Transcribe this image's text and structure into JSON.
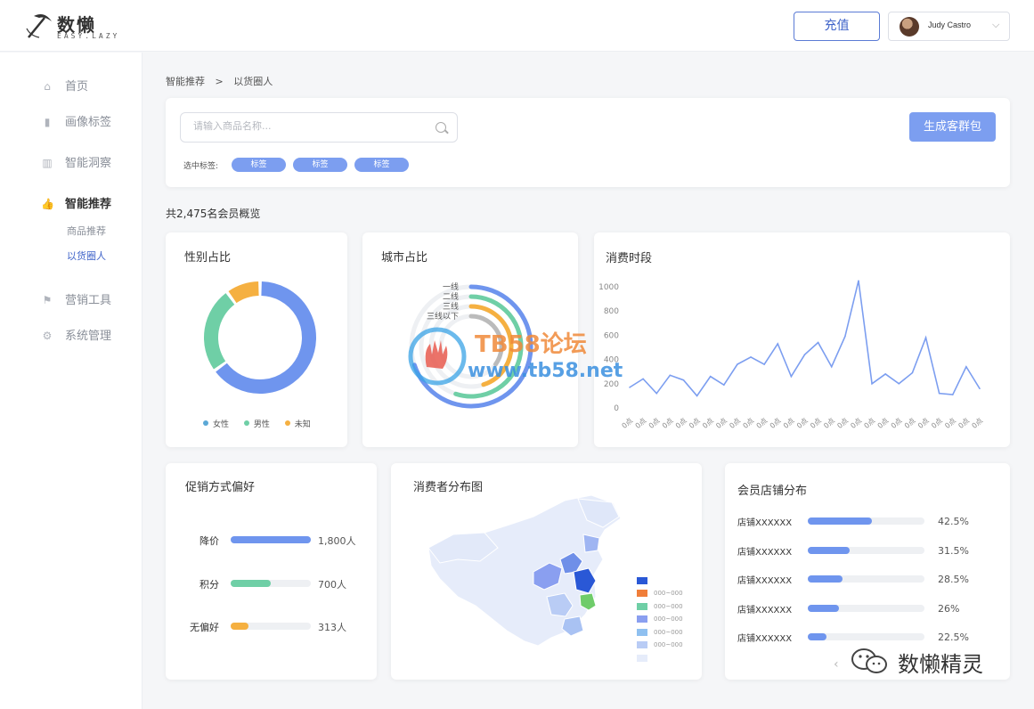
{
  "header": {
    "logo_title": "数懒",
    "logo_subtitle": "EASY.LAZY",
    "recharge_label": "充值",
    "user_name": "Judy Castro"
  },
  "sidebar": {
    "items": [
      {
        "label": "首页",
        "icon": "home-icon"
      },
      {
        "label": "画像标签",
        "icon": "bookmark-icon"
      },
      {
        "label": "智能洞察",
        "icon": "bar-chart-icon"
      },
      {
        "label": "智能推荐",
        "icon": "thumbs-up-icon"
      },
      {
        "label": "营销工具",
        "icon": "flag-icon"
      },
      {
        "label": "系统管理",
        "icon": "gear-icon"
      }
    ],
    "sub_items": [
      {
        "label": "商品推荐"
      },
      {
        "label": "以货圈人"
      }
    ],
    "active_item": "智能推荐",
    "active_sub_item": "以货圈人"
  },
  "breadcrumb": {
    "parent": "智能推荐",
    "separator": ">",
    "current": "以货圈人"
  },
  "search": {
    "placeholder": "请输入商品名称...",
    "tags_label": "选中标签:",
    "tags": [
      "标签",
      "标签",
      "标签"
    ],
    "generate_label": "生成客群包"
  },
  "overview_text": "共2,475名会员概览",
  "gender": {
    "title": "性别占比",
    "legend": [
      "女性",
      "男性",
      "未知"
    ],
    "colors": [
      "#6f95ee",
      "#6fcfa6",
      "#f5b041"
    ]
  },
  "city": {
    "title": "城市占比",
    "labels": [
      "一线",
      "二线",
      "三线",
      "三线以下"
    ],
    "colors": [
      "#6f95ee",
      "#6fcfa6",
      "#f5b041",
      "#bbbbbb"
    ]
  },
  "consumption": {
    "title": "消费时段",
    "y_ticks": [
      "1000",
      "800",
      "600",
      "400",
      "200",
      "0"
    ],
    "x_tick_label": "0点"
  },
  "promo": {
    "title": "促销方式偏好",
    "rows": [
      {
        "label": "降价",
        "value_text": "1,800人",
        "fraction": 1.0,
        "color": "#6f95ee"
      },
      {
        "label": "积分",
        "value_text": "700人",
        "fraction": 0.5,
        "color": "#6fcfa6"
      },
      {
        "label": "无偏好",
        "value_text": "313人",
        "fraction": 0.22,
        "color": "#f5b041"
      }
    ]
  },
  "map": {
    "title": "消费者分布图",
    "legend": [
      {
        "label": "",
        "color": "#2a58d6"
      },
      {
        "label": "000~000",
        "color": "#f07e3a"
      },
      {
        "label": "000~000",
        "color": "#6fcfa6"
      },
      {
        "label": "000~000",
        "color": "#8a9ff0"
      },
      {
        "label": "000~000",
        "color": "#8fc0f0"
      },
      {
        "label": "000~000",
        "color": "#b9ccf5"
      },
      {
        "label": "",
        "color": "#e6ecfa"
      }
    ]
  },
  "stores": {
    "title": "会员店铺分布",
    "rows": [
      {
        "label": "店铺XXXXXX",
        "pct_text": "42.5%",
        "fraction": 0.55
      },
      {
        "label": "店铺XXXXXX",
        "pct_text": "31.5%",
        "fraction": 0.36
      },
      {
        "label": "店铺XXXXXX",
        "pct_text": "28.5%",
        "fraction": 0.3
      },
      {
        "label": "店铺XXXXXX",
        "pct_text": "26%",
        "fraction": 0.27
      },
      {
        "label": "店铺XXXXXX",
        "pct_text": "22.5%",
        "fraction": 0.16
      }
    ],
    "bar_color": "#6f95ee",
    "pager_prev": "‹"
  },
  "watermarks": {
    "forum_name": "TB58论坛",
    "forum_url": "www.tb58.net",
    "wechat_name": "数懒精灵"
  },
  "chart_data": [
    {
      "type": "pie",
      "title": "性别占比",
      "categories": [
        "女性",
        "男性",
        "未知"
      ],
      "values": [
        65,
        25,
        10
      ]
    },
    {
      "type": "pie",
      "title": "城市占比",
      "categories": [
        "一线",
        "二线",
        "三线",
        "三线以下"
      ],
      "values": [
        70,
        55,
        45,
        35
      ]
    },
    {
      "type": "line",
      "title": "消费时段",
      "x": [
        "0点",
        "0点",
        "0点",
        "0点",
        "0点",
        "0点",
        "0点",
        "0点",
        "0点",
        "0点",
        "0点",
        "0点",
        "0点",
        "0点",
        "0点",
        "0点",
        "0点",
        "0点",
        "0点",
        "0点",
        "0点",
        "0点",
        "0点",
        "0点",
        "0点",
        "0点",
        "0点"
      ],
      "values": [
        170,
        240,
        120,
        270,
        230,
        100,
        260,
        190,
        360,
        420,
        360,
        530,
        260,
        440,
        540,
        340,
        590,
        1050,
        200,
        280,
        200,
        290,
        580,
        120,
        110,
        340,
        160
      ],
      "ylim": [
        0,
        1000
      ],
      "yticks": [
        0,
        200,
        400,
        600,
        800,
        1000
      ],
      "grid": false
    }
  ]
}
